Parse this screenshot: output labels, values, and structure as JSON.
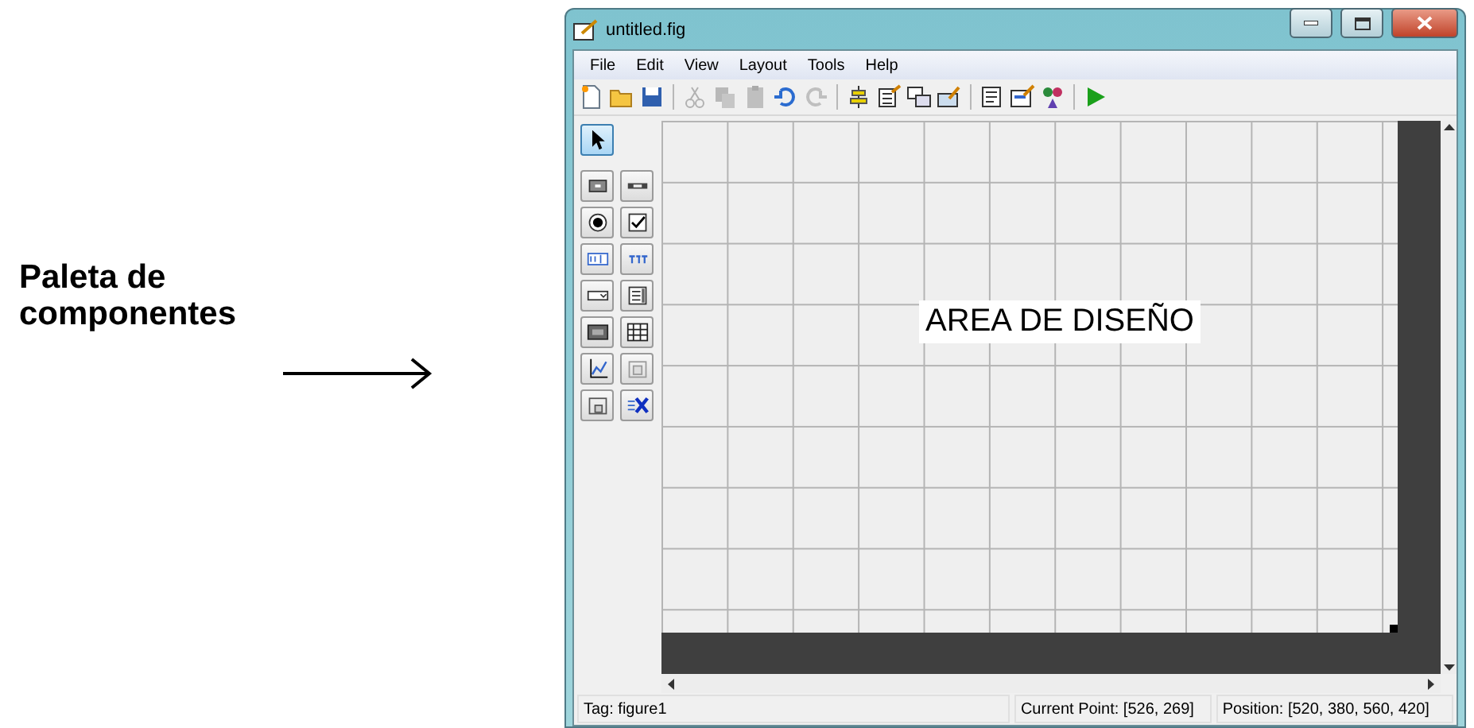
{
  "annotation": {
    "label": "Paleta de componentes"
  },
  "window": {
    "title": "untitled.fig"
  },
  "menu": [
    "File",
    "Edit",
    "View",
    "Layout",
    "Tools",
    "Help"
  ],
  "toolbar": [
    {
      "kind": "new",
      "disabled": false
    },
    {
      "kind": "open",
      "disabled": false
    },
    {
      "kind": "save",
      "disabled": false
    },
    {
      "kind": "sep"
    },
    {
      "kind": "cut",
      "disabled": true
    },
    {
      "kind": "copy",
      "disabled": true
    },
    {
      "kind": "paste",
      "disabled": true
    },
    {
      "kind": "undo",
      "disabled": false
    },
    {
      "kind": "redo",
      "disabled": true
    },
    {
      "kind": "sep"
    },
    {
      "kind": "align",
      "disabled": false
    },
    {
      "kind": "menu",
      "disabled": false
    },
    {
      "kind": "taborder",
      "disabled": false
    },
    {
      "kind": "toolbar",
      "disabled": false
    },
    {
      "kind": "sep"
    },
    {
      "kind": "editor",
      "disabled": false
    },
    {
      "kind": "inspector",
      "disabled": false
    },
    {
      "kind": "browser",
      "disabled": false
    },
    {
      "kind": "sep"
    },
    {
      "kind": "run",
      "disabled": false
    }
  ],
  "palette": [
    {
      "kind": "pointer",
      "selected": true
    },
    {
      "kind": "pushbutton",
      "selected": false
    },
    {
      "kind": "slider",
      "selected": false
    },
    {
      "kind": "radio",
      "selected": false
    },
    {
      "kind": "checkbox",
      "selected": false
    },
    {
      "kind": "edit",
      "selected": false
    },
    {
      "kind": "text",
      "selected": false
    },
    {
      "kind": "popup",
      "selected": false
    },
    {
      "kind": "listbox",
      "selected": false
    },
    {
      "kind": "toggle",
      "selected": false
    },
    {
      "kind": "table",
      "selected": false
    },
    {
      "kind": "axes",
      "selected": false
    },
    {
      "kind": "panel",
      "selected": false
    },
    {
      "kind": "buttongroup",
      "selected": false
    },
    {
      "kind": "activex",
      "selected": false
    }
  ],
  "design_area": {
    "label": "AREA DE DISEÑO"
  },
  "status_bar": [
    "Tag: figure1",
    "Current Point:  [526, 269]",
    "Position: [520, 380, 560, 420]"
  ]
}
